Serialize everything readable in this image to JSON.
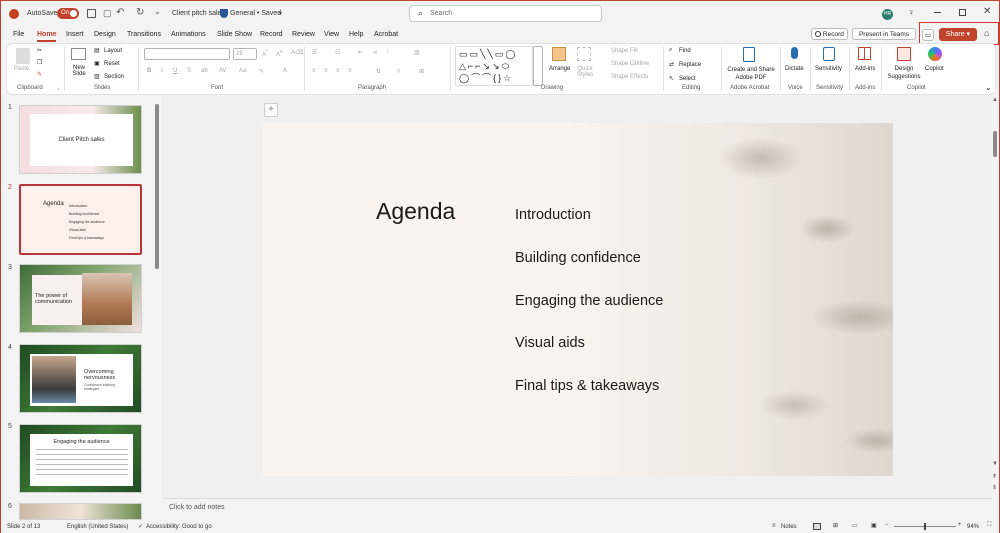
{
  "titlebar": {
    "autosave": "AutoSave",
    "toggle": "On",
    "doc_title": "Client pitch sale",
    "sensitivity": "General • Saved",
    "search_placeholder": "Search",
    "avatar": "HR"
  },
  "menu": [
    "File",
    "Home",
    "Insert",
    "Design",
    "Transitions",
    "Animations",
    "Slide Show",
    "Record",
    "Review",
    "View",
    "Help",
    "Acrobat"
  ],
  "actions": {
    "record": "Record",
    "present": "Present in Teams",
    "share": "Share"
  },
  "ribbon": {
    "clipboard": {
      "paste": "Paste",
      "label": "Clipboard"
    },
    "slides": {
      "new_slide": "New Slide",
      "layout": "Layout",
      "reset": "Reset",
      "section": "Section",
      "label": "Slides"
    },
    "font": {
      "size": "28",
      "label": "Font"
    },
    "paragraph": {
      "label": "Paragraph"
    },
    "drawing": {
      "arrange": "Arrange",
      "quick_styles": "Quick Styles",
      "shape_fill": "Shape Fill",
      "shape_outline": "Shape Outline",
      "shape_effects": "Shape Effects",
      "label": "Drawing"
    },
    "editing": {
      "find": "Find",
      "replace": "Replace",
      "select": "Select",
      "label": "Editing"
    },
    "acrobat": {
      "create": "Create and Share Adobe PDF",
      "label": "Adobe Acrobat"
    },
    "voice": {
      "dictate": "Dictate",
      "label": "Voice"
    },
    "sensitivity": {
      "btn": "Sensitivity",
      "label": "Sensitivity"
    },
    "addins": {
      "btn": "Add-ins",
      "label": "Add-ins"
    },
    "designer": {
      "btn": "Design Suggestions"
    },
    "copilot": {
      "btn": "Copilot",
      "label": "Copilot"
    }
  },
  "thumbnails": [
    {
      "num": "1",
      "title": "Client Pitch sales"
    },
    {
      "num": "2",
      "title": "Agenda",
      "items": [
        "Introduction",
        "Building confidence",
        "Engaging the audience",
        "Visual aids",
        "Final tips & takeaways"
      ]
    },
    {
      "num": "3",
      "title": "The power of communication"
    },
    {
      "num": "4",
      "title": "Overcoming nervousness",
      "sub": "Confidence-building strategies"
    },
    {
      "num": "5",
      "title": "Engaging the audience"
    },
    {
      "num": "6"
    }
  ],
  "slide": {
    "title": "Agenda",
    "items": [
      "Introduction",
      "Building confidence",
      "Engaging the audience",
      "Visual aids",
      "Final tips & takeaways"
    ]
  },
  "notes": {
    "placeholder": "Click to add notes"
  },
  "status": {
    "slide": "Slide 2 of 13",
    "lang": "English (United States)",
    "access": "Accessibility: Good to go",
    "notes": "Notes",
    "zoom": "94%"
  },
  "colors": {
    "accent": "#c2432c",
    "selected_thumb": "#b8343a"
  }
}
